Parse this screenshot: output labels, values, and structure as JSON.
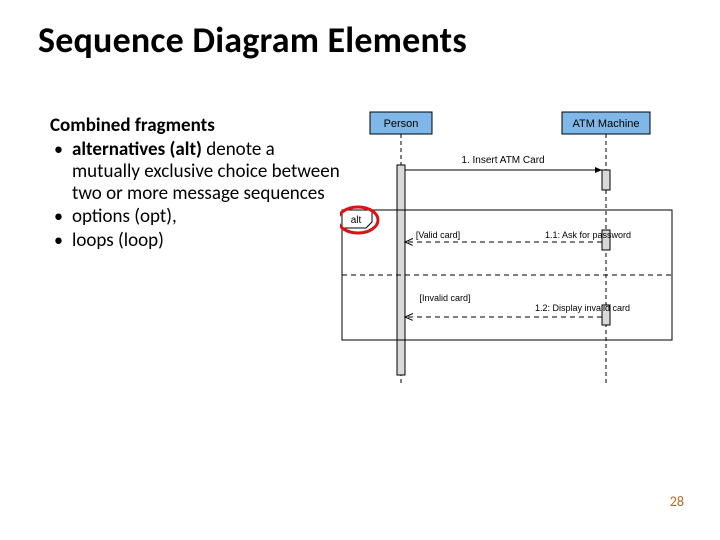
{
  "title": "Sequence Diagram Elements",
  "subhead": "Combined fragments",
  "bullets": {
    "b1_strong": "alternatives (alt)",
    "b1_rest": " denote a mutually exclusive choice between two or more message sequences",
    "b2": "options (opt),",
    "b3": "loops (loop)"
  },
  "diagram": {
    "lifeline1": "Person",
    "lifeline2": "ATM Machine",
    "msg1": "1. Insert ATM Card",
    "frag_label": "alt",
    "guard1": "[Valid card]",
    "msg2": "1.1: Ask for password",
    "guard2": "[Invalid card]",
    "msg3": "1.2: Display invalid card"
  },
  "page_number": "28"
}
